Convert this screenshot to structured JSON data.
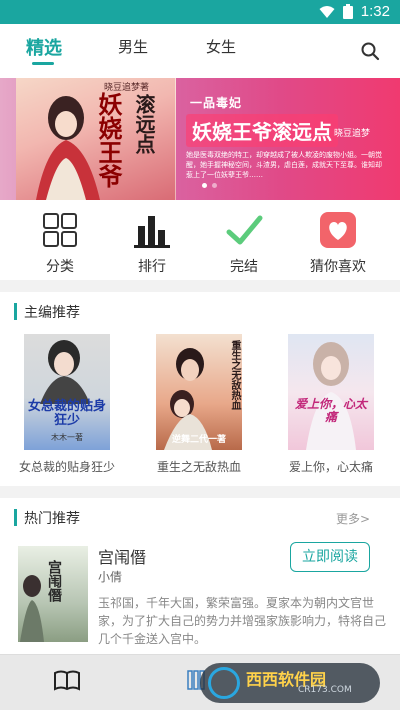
{
  "status_bar": {
    "time": "1:32",
    "icons": [
      "wifi-icon",
      "battery-icon"
    ]
  },
  "top_tabs": [
    {
      "label": "精选",
      "active": true
    },
    {
      "label": "男生",
      "active": false
    },
    {
      "label": "女生",
      "active": false
    }
  ],
  "banner": {
    "artist_tag": "晓豆追梦著",
    "vertical_title": "妖娆王爷",
    "vertical_title2": "滚远点",
    "slogan": "一品毒妃",
    "big_title": "妖娆王爷滚远点",
    "author": "晓豆追梦",
    "description": "她是医毒双绝的特工，却穿越成了被人欺凌的废物小姐。一朝觉醒，她手握神秘空间，斗渣男，虐白莲，成就天下至尊。谁知却惹上了一位妖孽王爷……"
  },
  "quick_nav": [
    {
      "label": "分类",
      "icon": "grid-icon"
    },
    {
      "label": "排行",
      "icon": "ranking-bars-icon"
    },
    {
      "label": "完结",
      "icon": "checkmark-icon"
    },
    {
      "label": "猜你喜欢",
      "icon": "heart-icon"
    }
  ],
  "editor_picks": {
    "title": "主编推荐",
    "books": [
      {
        "name": "女总裁的贴身狂少",
        "cover_text": "女总裁的贴身狂少",
        "cover_author": "木木一著"
      },
      {
        "name": "重生之无敌热血",
        "cover_text": "重生之无敌热血",
        "cover_author": "逆舞二代一著"
      },
      {
        "name": "爱上你，心太痛",
        "cover_text": "爱上你，心太痛",
        "cover_author": ""
      }
    ]
  },
  "hot_picks": {
    "title": "热门推荐",
    "more": "更多>",
    "book": {
      "title": "宫闱僭",
      "author": "小倩",
      "description": "玉祁国，千年大国，繁荣富强。夏家本为朝内文官世家，为了扩大自己的势力并增强家族影响力，特将自己几个千金送入宫中。",
      "button": "立即阅读",
      "cover_text": "宫闱僭"
    }
  },
  "bottom_bar": {
    "watermark_main": "西西软件园",
    "watermark_sub": "CR173.COM"
  }
}
